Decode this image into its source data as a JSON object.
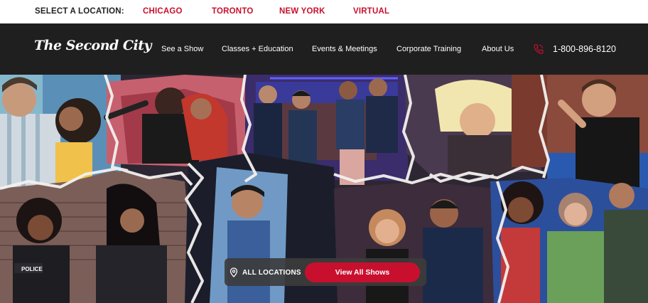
{
  "location_bar": {
    "label": "SELECT A LOCATION:",
    "links": [
      "CHICAGO",
      "TORONTO",
      "NEW YORK",
      "VIRTUAL"
    ]
  },
  "header": {
    "logo_text": "The Second City",
    "nav": [
      "See a Show",
      "Classes + Education",
      "Events & Meetings",
      "Corporate Training",
      "About Us"
    ],
    "phone_icon": "phone-icon",
    "phone": "1-800-896-8120"
  },
  "hero": {
    "location_select_icon": "map-pin-icon",
    "location_select_label": "ALL LOCATIONS",
    "cta_label": "View All Shows"
  },
  "colors": {
    "brand_red": "#c8102e",
    "header_bg": "#1f1f1f"
  }
}
